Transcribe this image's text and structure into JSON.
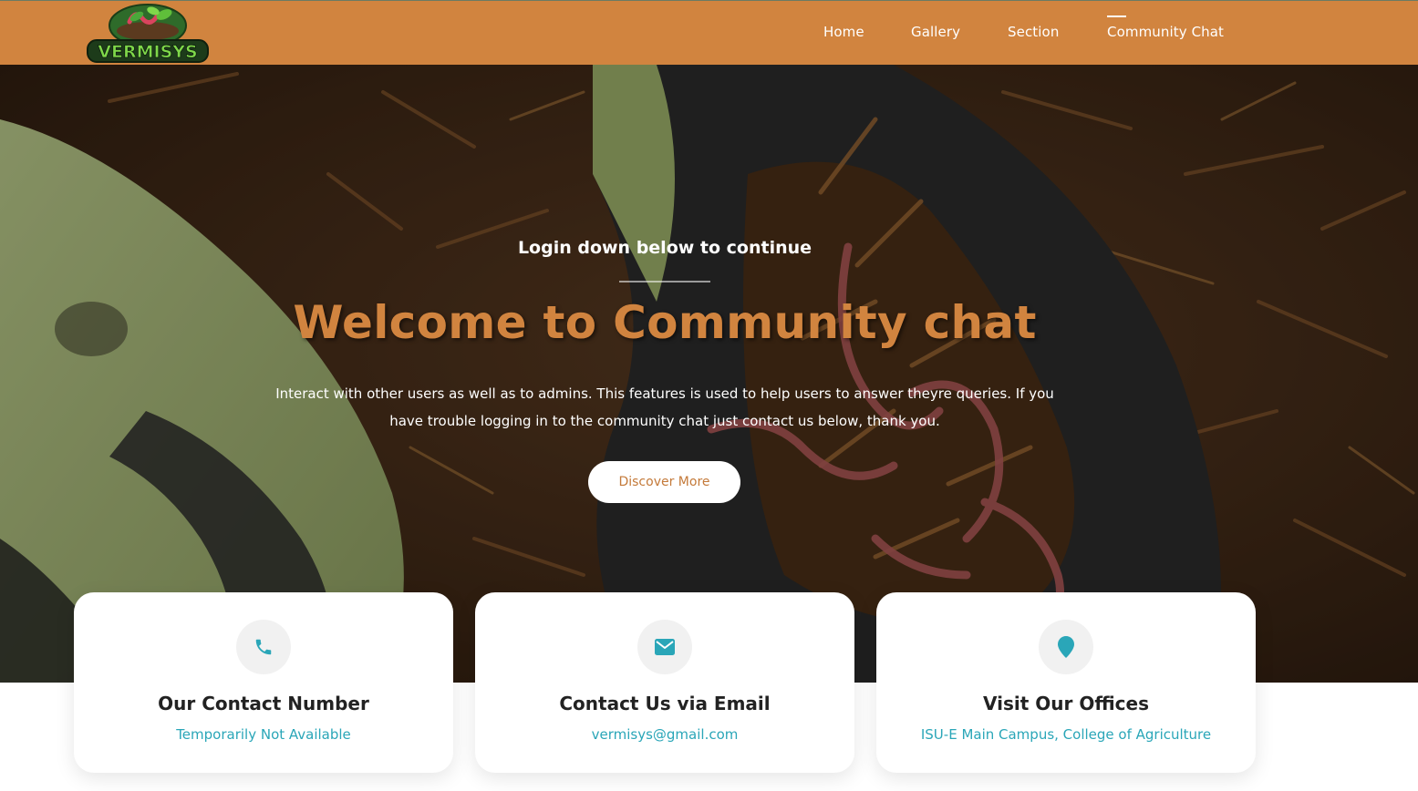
{
  "brand": {
    "logo_text": "VERMISYS"
  },
  "nav": {
    "items": [
      {
        "label": "Home"
      },
      {
        "label": "Gallery"
      },
      {
        "label": "Section"
      },
      {
        "label": "Community Chat",
        "active": true
      }
    ]
  },
  "hero": {
    "subtitle": "Login down below to continue",
    "title": "Welcome to Community chat",
    "description": "Interact with other users as well as to admins. This features is used to help users to answer theyre queries. If you have trouble logging in to the community chat just contact us below, thank you.",
    "button_label": "Discover More"
  },
  "contacts": [
    {
      "icon": "phone-icon",
      "title": "Our Contact Number",
      "value": "Temporarily Not Available"
    },
    {
      "icon": "envelope-icon",
      "title": "Contact Us via Email",
      "value": "vermisys@gmail.com"
    },
    {
      "icon": "map-pin-icon",
      "title": "Visit Our Offices",
      "value": "ISU-E Main Campus, College of Agriculture"
    }
  ],
  "colors": {
    "brand_orange": "#d1843f",
    "accent_teal": "#2aa6b8",
    "button_text": "#c47a3a"
  }
}
